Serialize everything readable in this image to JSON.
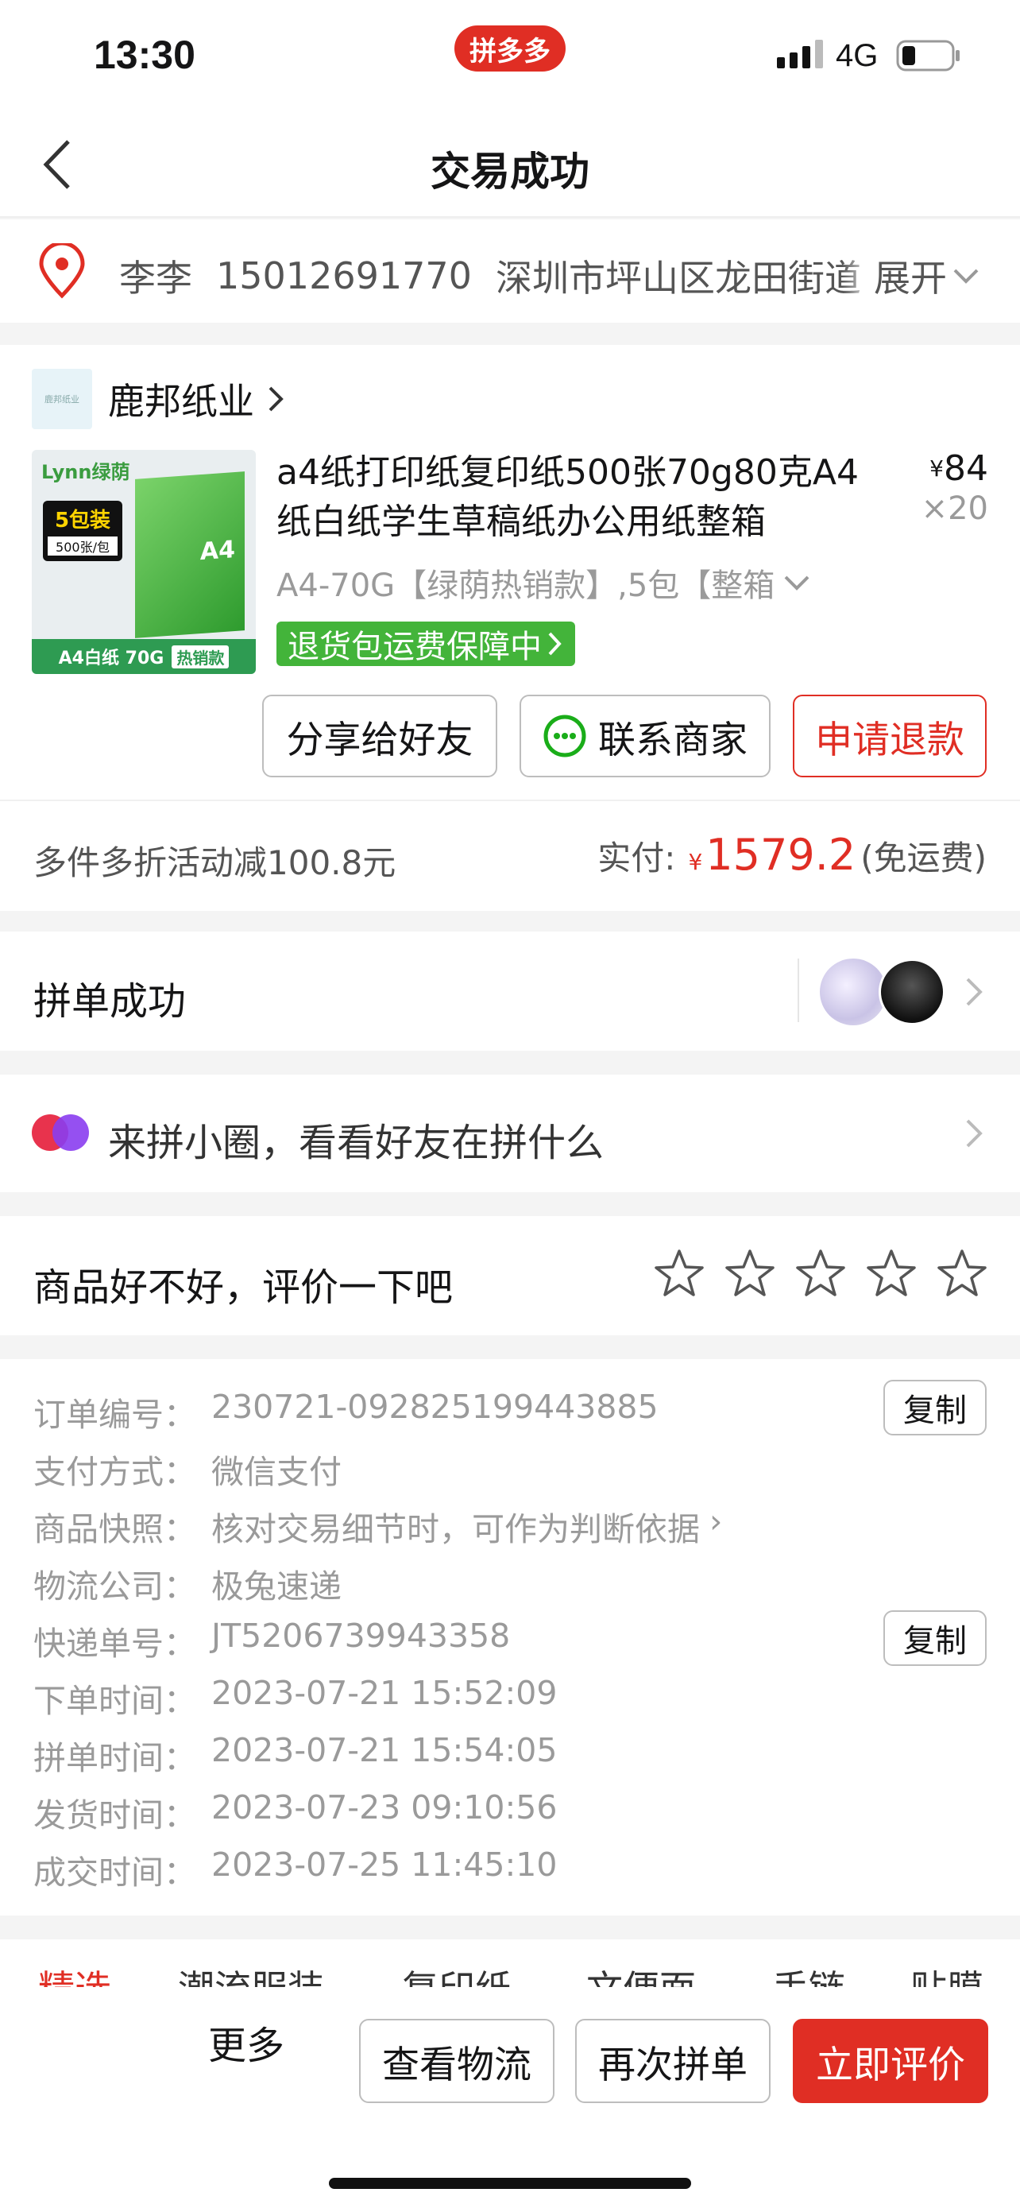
{
  "status_bar": {
    "time": "13:30",
    "app_badge": "拼多多",
    "network": "4G"
  },
  "nav": {
    "title": "交易成功"
  },
  "address": {
    "name": "李李",
    "phone": "15012691770",
    "text": "深圳市坪山区龙田街道",
    "expand": "展开"
  },
  "store": {
    "logo_text": "鹿邦纸业",
    "name": "鹿邦纸业"
  },
  "product": {
    "title": "a4纸打印纸复印纸500张70g80克A4纸白纸学生草稿纸办公用纸整箱",
    "currency": "¥",
    "price": "84",
    "qty": "×20",
    "spec": "A4-70G【绿荫热销款】,5包【整箱",
    "guarantee": "退货包运费保障中",
    "image_brand": "Lynn绿荫",
    "image_pack": "5包装",
    "image_pack_sub": "500张/包",
    "image_box": "A4",
    "image_footer": "A4白纸 70G",
    "image_hot": "热销款"
  },
  "actions": {
    "share": "分享给好友",
    "contact": "联系商家",
    "refund": "申请退款"
  },
  "payment": {
    "discount": "多件多折活动减100.8元",
    "paid_label": "实付:",
    "currency": "¥",
    "paid_value": "1579.2",
    "shipping": "(免运费)"
  },
  "group": {
    "label": "拼单成功"
  },
  "circle": {
    "label": "来拼小圈，看看好友在拼什么"
  },
  "review": {
    "label": "商品好不好，评价一下吧",
    "rating": 0,
    "max": 5
  },
  "order_info": {
    "copy": "复制",
    "rows": [
      {
        "k": "订单编号：",
        "v": "230721-092825199443885"
      },
      {
        "k": "支付方式：",
        "v": "微信支付"
      },
      {
        "k": "商品快照：",
        "v": "核对交易细节时，可作为判断依据"
      },
      {
        "k": "物流公司：",
        "v": "极兔速递"
      },
      {
        "k": "快递单号：",
        "v": "JT5206739943358"
      },
      {
        "k": "下单时间：",
        "v": "2023-07-21 15:52:09"
      },
      {
        "k": "拼单时间：",
        "v": "2023-07-21 15:54:05"
      },
      {
        "k": "发货时间：",
        "v": "2023-07-23 09:10:56"
      },
      {
        "k": "成交时间：",
        "v": "2023-07-25 11:45:10"
      }
    ]
  },
  "category_tabs": [
    "精选",
    "潮流服装",
    "复印纸",
    "文便面",
    "手链",
    "贴膜"
  ],
  "bottom_bar": {
    "more": "更多",
    "logistics": "查看物流",
    "reorder": "再次拼单",
    "review": "立即评价"
  },
  "colors": {
    "brand_red": "#e02e24",
    "guarantee_green": "#43b43a",
    "wechat_green": "#1aad19"
  }
}
